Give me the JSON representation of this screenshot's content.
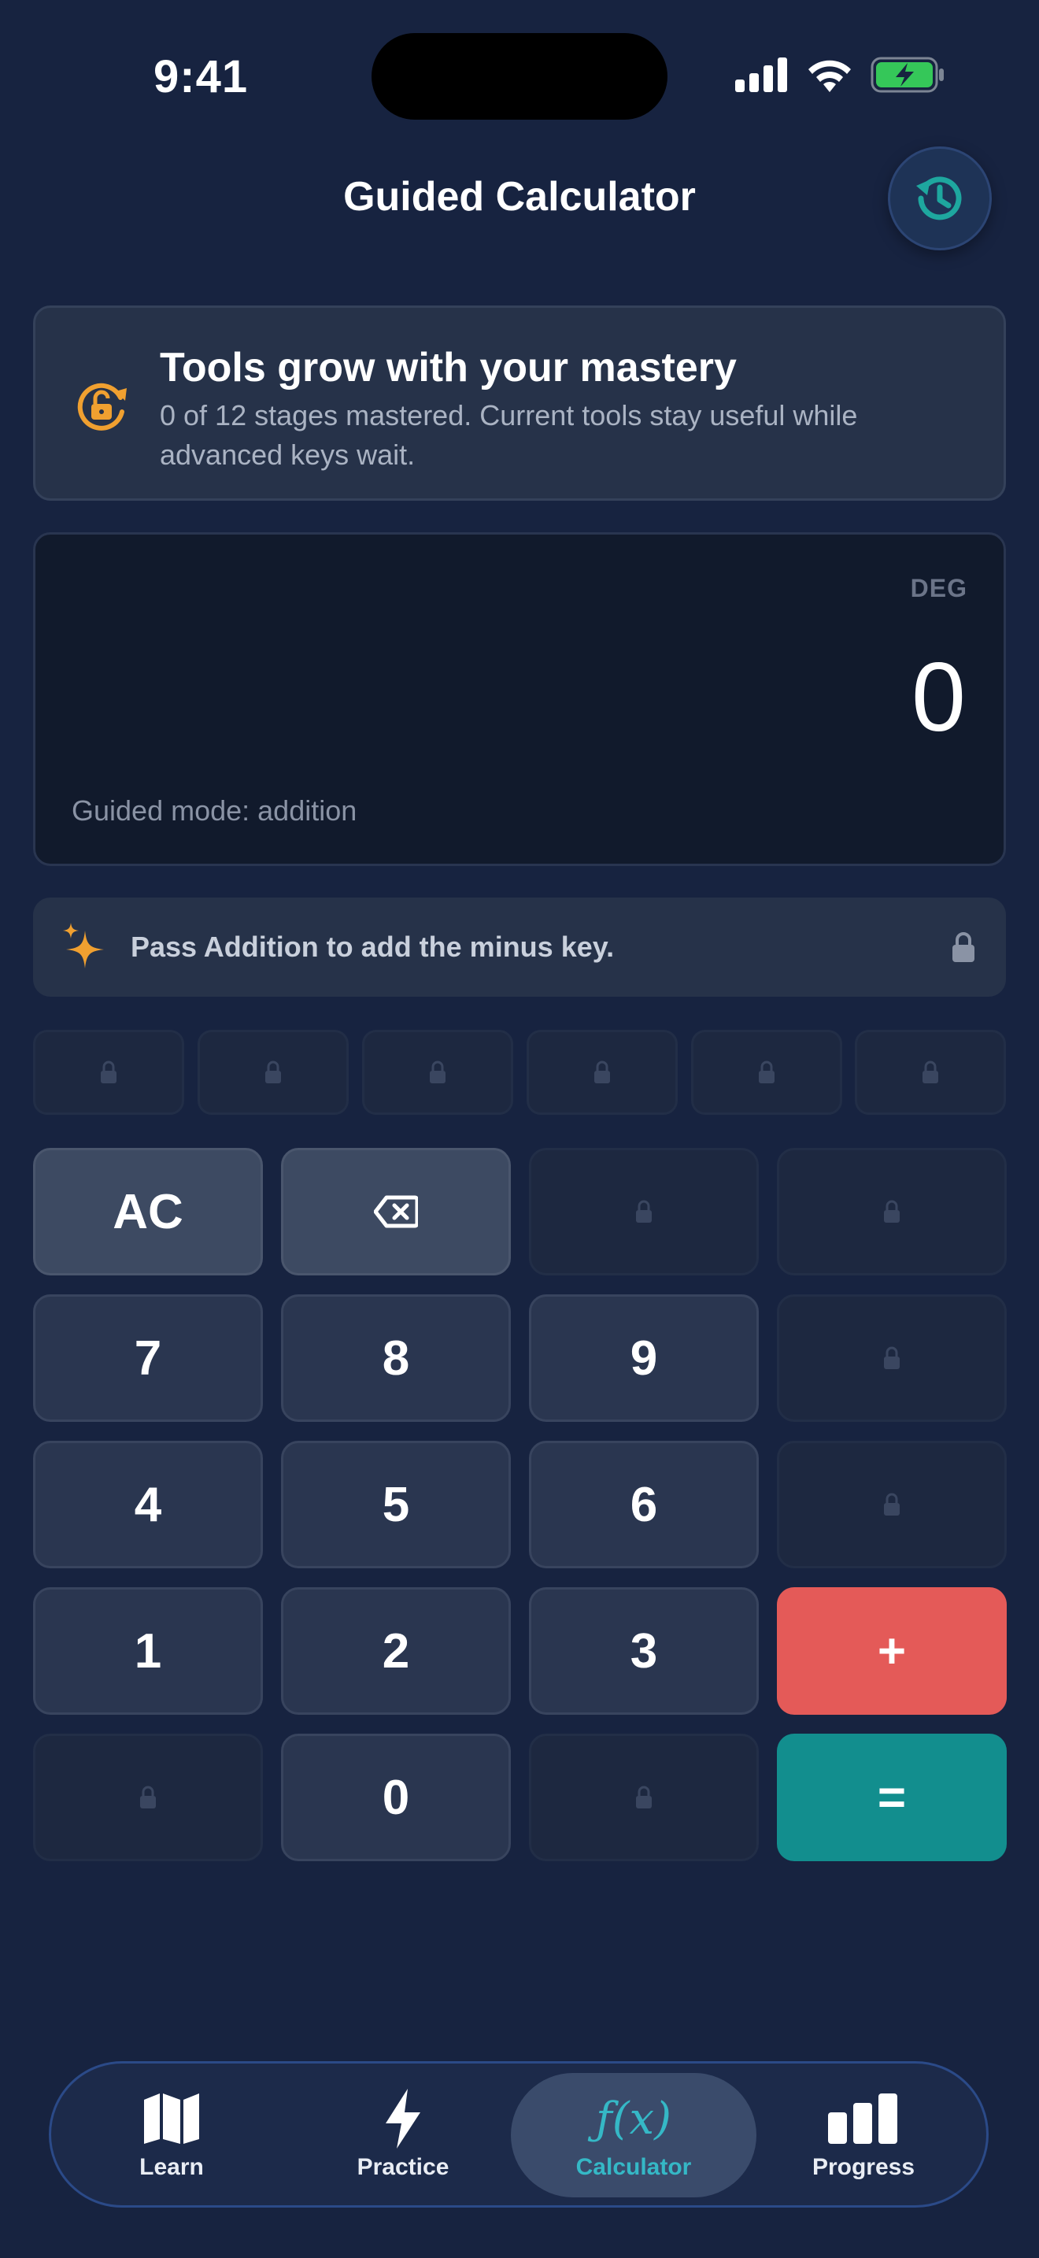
{
  "status": {
    "time": "9:41"
  },
  "header": {
    "title": "Guided Calculator"
  },
  "mastery": {
    "title": "Tools grow with your mastery",
    "description": "0 of 12 stages mastered. Current tools stay useful while advanced keys wait."
  },
  "display": {
    "angle_mode": "DEG",
    "value": "0",
    "mode_label": "Guided mode: addition"
  },
  "hint": {
    "text": "Pass Addition to add the minus key."
  },
  "keys": {
    "ac": "AC",
    "seven": "7",
    "eight": "8",
    "nine": "9",
    "four": "4",
    "five": "5",
    "six": "6",
    "one": "1",
    "two": "2",
    "three": "3",
    "plus": "+",
    "zero": "0",
    "equals": "="
  },
  "nav": {
    "learn": "Learn",
    "practice": "Practice",
    "calculator": "Calculator",
    "calculator_icon": "ƒ(x)",
    "progress": "Progress"
  },
  "colors": {
    "background": "#172340",
    "accent_teal": "#128e8e",
    "plus_red": "#e45a58",
    "orange": "#f0a030",
    "active_nav_text": "#35b8c6"
  }
}
